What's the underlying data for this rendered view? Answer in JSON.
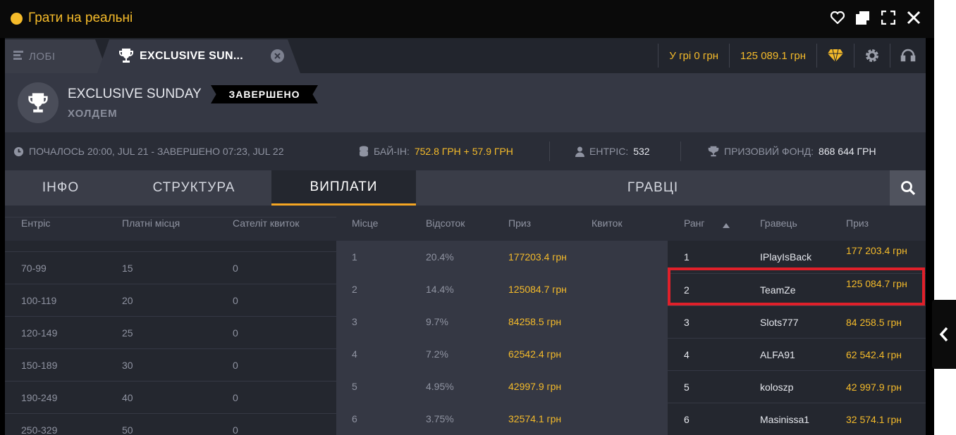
{
  "window": {
    "title": "Грати на реальні",
    "icons": [
      "heart-icon",
      "restore-icon",
      "fullscreen-icon",
      "close-icon"
    ]
  },
  "tabs": {
    "lobby": "ЛОБІ",
    "active": "EXCLUSIVE SUN..."
  },
  "topbar": {
    "in_game": "У грі 0 грн",
    "balance": "125 089.1 грн"
  },
  "header": {
    "name": "EXCLUSIVE SUNDAY",
    "type": "ХОЛДЕМ",
    "status": "ЗАВЕРШЕНО"
  },
  "info": {
    "time": "ПОЧАЛОСЬ 20:00, JUL 21 - ЗАВЕРШЕНО 07:23, JUL 22",
    "buyin_label": "БАЙ-ІН:",
    "buyin_value": "752.8 ГРН + 57.9 ГРН",
    "entries_label": "ЕНТРІС:",
    "entries_value": "532",
    "prize_label": "ПРИЗОВИЙ ФОНД:",
    "prize_value": "868 644 ГРН"
  },
  "subtabs": {
    "info": "ІНФО",
    "structure": "СТРУКТУРА",
    "payouts": "ВИПЛАТИ",
    "players": "ГРАВЦІ"
  },
  "left_table": {
    "headers": [
      "Ентріс",
      "Платні місця",
      "Сателіт квиток"
    ],
    "rows": [
      [
        "70-99",
        "15",
        "0"
      ],
      [
        "100-119",
        "20",
        "0"
      ],
      [
        "120-149",
        "25",
        "0"
      ],
      [
        "150-189",
        "30",
        "0"
      ],
      [
        "190-249",
        "40",
        "0"
      ],
      [
        "250-329",
        "50",
        "0"
      ]
    ]
  },
  "mid_table": {
    "headers": [
      "Місце",
      "Відсоток",
      "Приз",
      "Квиток"
    ],
    "rows": [
      [
        "1",
        "20.4%",
        "177203.4 грн"
      ],
      [
        "2",
        "14.4%",
        "125084.7 грн"
      ],
      [
        "3",
        "9.7%",
        "84258.5 грн"
      ],
      [
        "4",
        "7.2%",
        "62542.4 грн"
      ],
      [
        "5",
        "4.95%",
        "42997.9 грн"
      ],
      [
        "6",
        "3.75%",
        "32574.1 грн"
      ]
    ]
  },
  "right_table": {
    "headers": [
      "Ранг",
      "Гравець",
      "Приз"
    ],
    "rows": [
      [
        "1",
        "IPlayIsBack",
        "177 203.4 грн"
      ],
      [
        "2",
        "TeamZe",
        "125 084.7 грн"
      ],
      [
        "3",
        "Slots777",
        "84 258.5 грн"
      ],
      [
        "4",
        "ALFA91",
        "62 542.4 грн"
      ],
      [
        "5",
        "koloszp",
        "42 997.9 грн"
      ],
      [
        "6",
        "Masinissa1",
        "32 574.1 грн"
      ]
    ]
  },
  "colors": {
    "accent": "#f5bb2a",
    "highlight": "#e0202a"
  }
}
